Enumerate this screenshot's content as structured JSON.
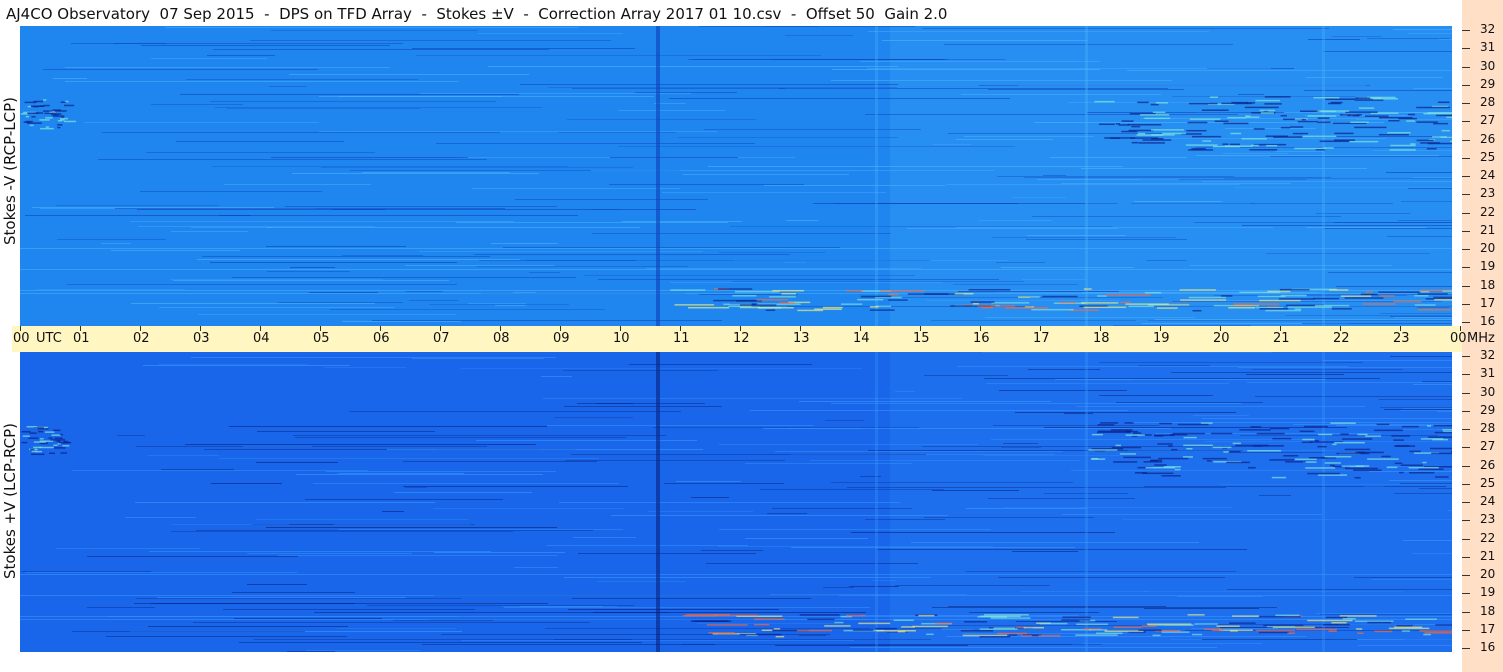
{
  "title": "AJ4CO Observatory  07 Sep 2015  -  DPS on TFD Array  -  Stokes ±V  -  Correction Array 2017 01 10.csv  -  Offset 50  Gain 2.0",
  "panels": [
    {
      "ylabel": "Stokes -V (RCP-LCP)",
      "colormap_base": "#1f86f0"
    },
    {
      "ylabel": "Stokes +V (LCP-RCP)",
      "colormap_base": "#1966ea"
    }
  ],
  "time_axis": {
    "labels": [
      "00",
      "UTC",
      "01",
      "02",
      "03",
      "04",
      "05",
      "06",
      "07",
      "08",
      "09",
      "10",
      "11",
      "12",
      "13",
      "14",
      "15",
      "16",
      "17",
      "18",
      "19",
      "20",
      "21",
      "22",
      "23",
      "00",
      "MHz"
    ]
  },
  "freq_axis": {
    "labels": [
      "32",
      "31",
      "30",
      "29",
      "28",
      "27",
      "26",
      "25",
      "24",
      "23",
      "22",
      "21",
      "20",
      "19",
      "18",
      "17",
      "16"
    ]
  },
  "chart_data": {
    "type": "heatmap",
    "title": "AJ4CO Observatory  07 Sep 2015  -  DPS on TFD Array  -  Stokes ±V  -  Correction Array 2017 01 10.csv  -  Offset 50  Gain 2.0",
    "xlabel": "UTC",
    "x_ticks": [
      "00",
      "01",
      "02",
      "03",
      "04",
      "05",
      "06",
      "07",
      "08",
      "09",
      "10",
      "11",
      "12",
      "13",
      "14",
      "15",
      "16",
      "17",
      "18",
      "19",
      "20",
      "21",
      "22",
      "23",
      "00"
    ],
    "x_range_hours": [
      0,
      24
    ],
    "ylabel": "MHz",
    "y_ticks": [
      32,
      31,
      30,
      29,
      28,
      27,
      26,
      25,
      24,
      23,
      22,
      21,
      20,
      19,
      18,
      17,
      16
    ],
    "y_range": [
      16,
      32
    ],
    "panels": [
      "Stokes -V (RCP-LCP)",
      "Stokes +V (LCP-RCP)"
    ],
    "colormap": [
      "#0b1f8a",
      "#1966ea",
      "#2f9cff",
      "#7ee8e0",
      "#f4f07a",
      "#ff6a3a"
    ]
  }
}
